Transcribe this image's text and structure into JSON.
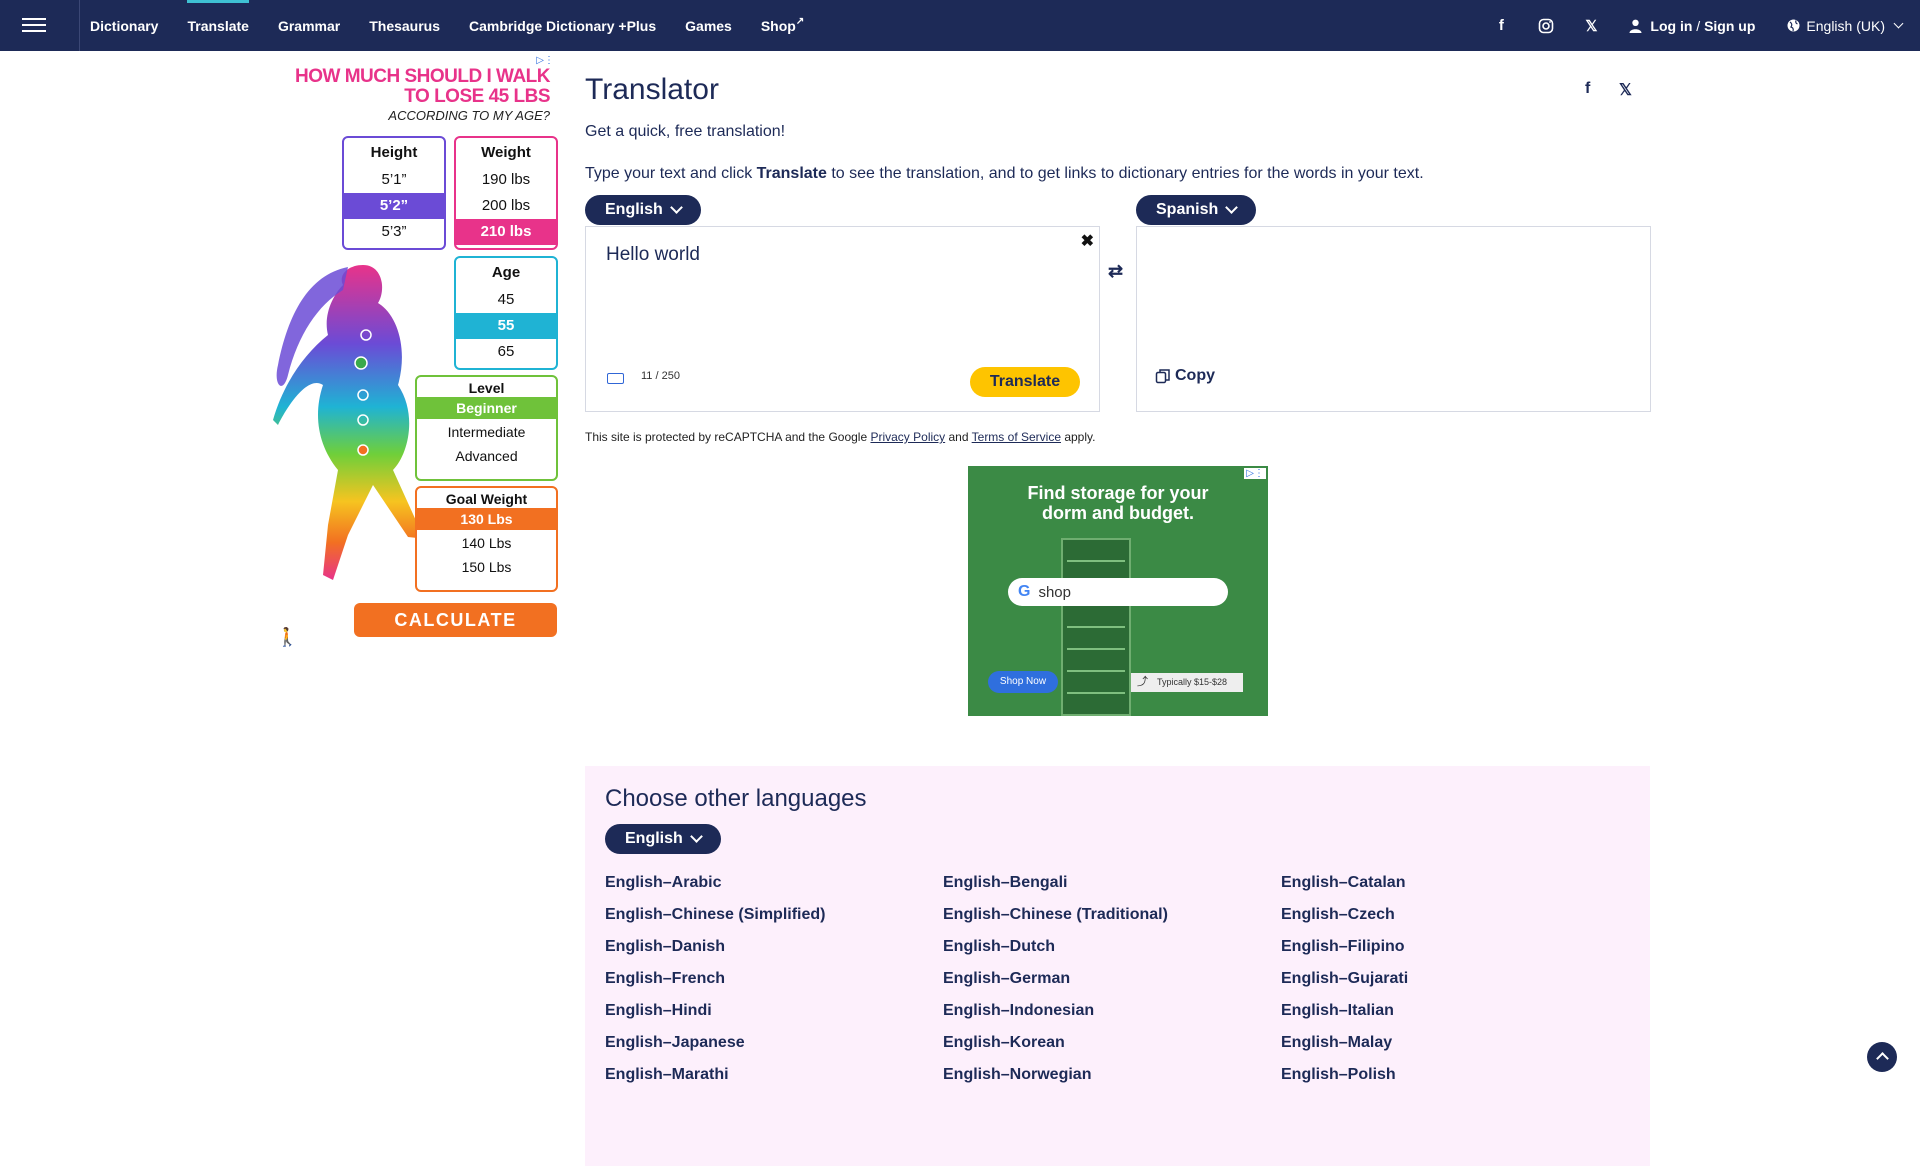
{
  "nav": {
    "links": [
      {
        "label": "Dictionary",
        "active": false
      },
      {
        "label": "Translate",
        "active": true
      },
      {
        "label": "Grammar",
        "active": false
      },
      {
        "label": "Thesaurus",
        "active": false
      },
      {
        "label": "Cambridge Dictionary +Plus",
        "active": false
      },
      {
        "label": "Games",
        "active": false
      },
      {
        "label": "Shop",
        "active": false
      }
    ],
    "login_label": "Log in",
    "login_sep": "/",
    "signup_label": "Sign up",
    "language_label": "English (UK)",
    "icons": [
      "facebook-icon",
      "instagram-icon",
      "x-icon",
      "user-icon",
      "globe-icon"
    ]
  },
  "ad_left": {
    "headline": "HOW MUCH SHOULD I WALK TO LOSE 45 LBS",
    "subhead": "ACCORDING TO MY AGE?",
    "height": {
      "title": "Height",
      "options": [
        "5’1”",
        "5’2”",
        "5’3”"
      ],
      "selected": 1
    },
    "weight": {
      "title": "Weight",
      "options": [
        "190 lbs",
        "200 lbs",
        "210 lbs"
      ],
      "selected": 2
    },
    "age": {
      "title": "Age",
      "options": [
        "45",
        "55",
        "65"
      ],
      "selected": 1
    },
    "level": {
      "title": "Level",
      "options": [
        "Beginner",
        "Intermediate",
        "Advanced"
      ],
      "selected": 0
    },
    "goal": {
      "title": "Goal Weight",
      "options": [
        "130 Lbs",
        "140 Lbs",
        "150 Lbs"
      ],
      "selected": 0
    },
    "cta": "CALCULATE"
  },
  "translator": {
    "title": "Translator",
    "subtitle": "Get a quick, free translation!",
    "instr_pre": "Type your text and click ",
    "instr_bold": "Translate",
    "instr_post": " to see the translation, and to get links to dictionary entries for the words in your text.",
    "source_lang": "English",
    "target_lang": "Spanish",
    "source_text": "Hello world",
    "char_count": "11 / 250",
    "translate_label": "Translate",
    "copy_label": "Copy",
    "recaptcha_pre": "This site is protected by reCAPTCHA and the Google ",
    "privacy": "Privacy Policy",
    "and": " and ",
    "terms": "Terms of Service",
    "apply": " apply."
  },
  "ad_center": {
    "headline": "Find storage for your dorm and budget.",
    "search_text": "shop",
    "cta": "Shop Now",
    "price": "Typically $15-$28"
  },
  "other_languages": {
    "heading": "Choose other languages",
    "selector": "English",
    "pairs": [
      "English–Arabic",
      "English–Bengali",
      "English–Catalan",
      "English–Chinese (Simplified)",
      "English–Chinese (Traditional)",
      "English–Czech",
      "English–Danish",
      "English–Dutch",
      "English–Filipino",
      "English–French",
      "English–German",
      "English–Gujarati",
      "English–Hindi",
      "English–Indonesian",
      "English–Italian",
      "English–Japanese",
      "English–Korean",
      "English–Malay",
      "English–Marathi",
      "English–Norwegian",
      "English–Polish"
    ]
  }
}
